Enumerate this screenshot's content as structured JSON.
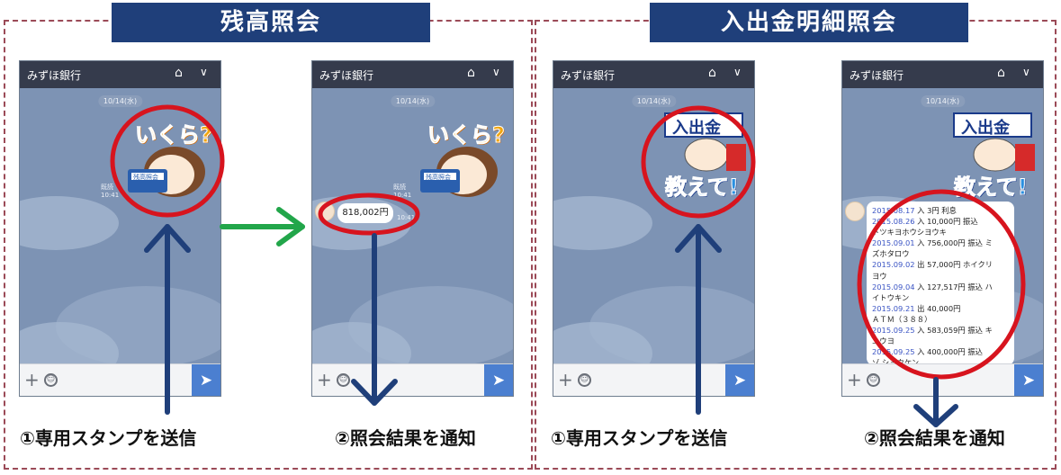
{
  "sections": [
    {
      "title": "残高照会",
      "step1": "①専用スタンプを送信",
      "step2": "②照会結果を通知"
    },
    {
      "title": "入出金明細照会",
      "step1": "①専用スタンプを送信",
      "step2": "②照会結果を通知"
    }
  ],
  "phone": {
    "bank_name": "みずほ銀行",
    "date_chip": "10/14(水)",
    "read_label": "既読",
    "time": "10:41"
  },
  "stickers": {
    "balance_text": "いくら?",
    "balance_book_label": "残高照会",
    "statement_top": "入出金",
    "statement_bottom": "教えて!"
  },
  "balance_result": {
    "amount": "818,002円",
    "time": "10:41"
  },
  "statement_lines": [
    {
      "date": "2015.08.17",
      "text": " 入 3円 利息"
    },
    {
      "date": "2015.08.26",
      "text": " 入 10,000円 振込"
    },
    {
      "date": "",
      "text": "トツキヨホウシヨウキ"
    },
    {
      "date": "2015.09.01",
      "text": " 入 756,000円 振込 ミ"
    },
    {
      "date": "",
      "text": "ズホタロウ"
    },
    {
      "date": "2015.09.02",
      "text": " 出 57,000円 ホイクリ"
    },
    {
      "date": "",
      "text": "ヨウ"
    },
    {
      "date": "2015.09.04",
      "text": " 入 127,517円 振込 ハ"
    },
    {
      "date": "",
      "text": "イトウキン"
    },
    {
      "date": "2015.09.21",
      "text": " 出 40,000円"
    },
    {
      "date": "",
      "text": "ＡＴＭ（３８８）"
    },
    {
      "date": "2015.09.25",
      "text": " 入 583,059円 振込 キ"
    },
    {
      "date": "",
      "text": "ユウヨ"
    },
    {
      "date": "2015.09.25",
      "text": " 入 400,000円 振込"
    },
    {
      "date": "",
      "text": "ゾ シヨウケン"
    }
  ],
  "colors": {
    "title_bg": "#1f3f7a",
    "phone_bg": "#7d93b4",
    "header_bg": "#353b4c",
    "send_btn": "#4b7fd0",
    "highlight_circle": "#d7141e",
    "flow_arrow": "#1f3f7a",
    "transition_arrow": "#22a64a"
  }
}
